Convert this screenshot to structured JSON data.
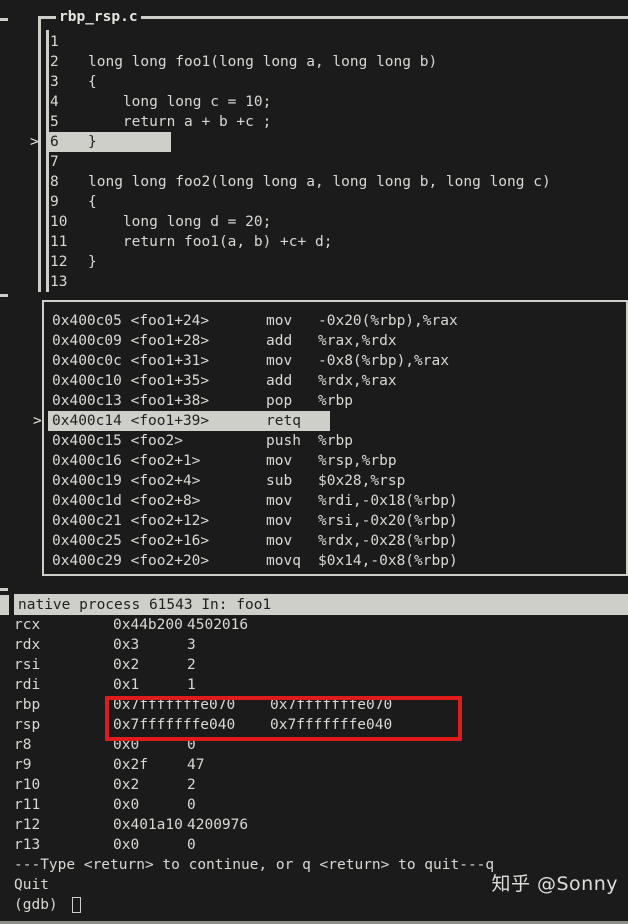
{
  "window": {
    "title": "rbp_rsp.c",
    "colors": {
      "background": "#1b1b1b",
      "foreground": "#d9d9d4",
      "border": "#cfcfc9",
      "highlight_bg": "#cfcfc9",
      "highlight_fg": "#222222",
      "annotation_red": "#e01b1b"
    }
  },
  "source_panel": {
    "title": "rbp_rsp.c",
    "current_marker": ">",
    "current_line": 6,
    "lines": [
      {
        "no": "1",
        "text": ""
      },
      {
        "no": "2",
        "text": "long long foo1(long long a, long long b)"
      },
      {
        "no": "3",
        "text": "{"
      },
      {
        "no": "4",
        "text": "    long long c = 10;"
      },
      {
        "no": "5",
        "text": "    return a + b +c ;"
      },
      {
        "no": "6",
        "text": "}"
      },
      {
        "no": "7",
        "text": ""
      },
      {
        "no": "8",
        "text": "long long foo2(long long a, long long b, long long c)"
      },
      {
        "no": "9",
        "text": "{"
      },
      {
        "no": "10",
        "text": "    long long d = 20;"
      },
      {
        "no": "11",
        "text": "    return foo1(a, b) +c+ d;"
      },
      {
        "no": "12",
        "text": "}"
      },
      {
        "no": "13",
        "text": ""
      }
    ]
  },
  "asm_panel": {
    "current_marker": ">",
    "current_index": 5,
    "rows": [
      {
        "addr": "0x400c05 <foo1+24>",
        "mnemonic": "mov",
        "operands": "-0x20(%rbp),%rax"
      },
      {
        "addr": "0x400c09 <foo1+28>",
        "mnemonic": "add",
        "operands": "%rax,%rdx"
      },
      {
        "addr": "0x400c0c <foo1+31>",
        "mnemonic": "mov",
        "operands": "-0x8(%rbp),%rax"
      },
      {
        "addr": "0x400c10 <foo1+35>",
        "mnemonic": "add",
        "operands": "%rdx,%rax"
      },
      {
        "addr": "0x400c13 <foo1+38>",
        "mnemonic": "pop",
        "operands": "%rbp"
      },
      {
        "addr": "0x400c14 <foo1+39>",
        "mnemonic": "retq",
        "operands": ""
      },
      {
        "addr": "0x400c15 <foo2>",
        "mnemonic": "push",
        "operands": "%rbp"
      },
      {
        "addr": "0x400c16 <foo2+1>",
        "mnemonic": "mov",
        "operands": "%rsp,%rbp"
      },
      {
        "addr": "0x400c19 <foo2+4>",
        "mnemonic": "sub",
        "operands": "$0x28,%rsp"
      },
      {
        "addr": "0x400c1d <foo2+8>",
        "mnemonic": "mov",
        "operands": "%rdi,-0x18(%rbp)"
      },
      {
        "addr": "0x400c21 <foo2+12>",
        "mnemonic": "mov",
        "operands": "%rsi,-0x20(%rbp)"
      },
      {
        "addr": "0x400c25 <foo2+16>",
        "mnemonic": "mov",
        "operands": "%rdx,-0x28(%rbp)"
      },
      {
        "addr": "0x400c29 <foo2+20>",
        "mnemonic": "movq",
        "operands": "$0x14,-0x8(%rbp)"
      }
    ]
  },
  "status_bar": {
    "text": "native process 61543 In: foo1"
  },
  "registers": [
    {
      "name": "rcx",
      "hex": "0x44b200",
      "dec": "4502016"
    },
    {
      "name": "rdx",
      "hex": "0x3",
      "dec": "3"
    },
    {
      "name": "rsi",
      "hex": "0x2",
      "dec": "2"
    },
    {
      "name": "rdi",
      "hex": "0x1",
      "dec": "1"
    },
    {
      "name": "rbp",
      "hex": "0x7fffffffe070",
      "dec": "0x7fffffffe070"
    },
    {
      "name": "rsp",
      "hex": "0x7fffffffe040",
      "dec": "0x7fffffffe040"
    },
    {
      "name": "r8",
      "hex": "0x0",
      "dec": "0"
    },
    {
      "name": "r9",
      "hex": "0x2f",
      "dec": "47"
    },
    {
      "name": "r10",
      "hex": "0x2",
      "dec": "2"
    },
    {
      "name": "r11",
      "hex": "0x0",
      "dec": "0"
    },
    {
      "name": "r12",
      "hex": "0x401a10",
      "dec": "4200976"
    },
    {
      "name": "r13",
      "hex": "0x0",
      "dec": "0"
    }
  ],
  "console": {
    "pager_prompt": "---Type <return> to continue, or q <return> to quit---q",
    "quit_message": "Quit",
    "prompt": "(gdb) "
  },
  "annotation": {
    "type": "red-rectangle",
    "highlights": [
      "rbp",
      "rsp"
    ]
  },
  "watermark": {
    "text": "知乎 @Sonny"
  }
}
